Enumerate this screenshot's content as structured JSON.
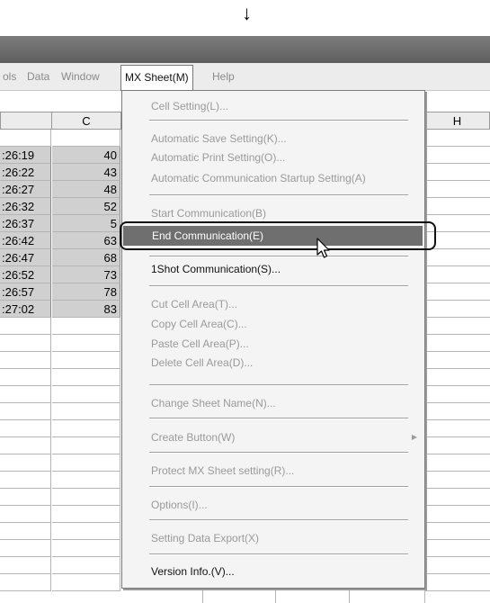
{
  "arrow": "↓",
  "menubar": {
    "items": [
      {
        "label": "ols"
      },
      {
        "label": "Data"
      },
      {
        "label": "Window"
      },
      {
        "label": "MX Sheet(M)"
      },
      {
        "label": "Help"
      }
    ]
  },
  "sheet": {
    "column_headers": [
      "C",
      "H"
    ],
    "rows": [
      {
        "time": ":26:19",
        "value": "40"
      },
      {
        "time": ":26:22",
        "value": "43"
      },
      {
        "time": ":26:27",
        "value": "48"
      },
      {
        "time": ":26:32",
        "value": "52"
      },
      {
        "time": ":26:37",
        "value": "5"
      },
      {
        "time": ":26:42",
        "value": "63"
      },
      {
        "time": ":26:47",
        "value": "68"
      },
      {
        "time": ":26:52",
        "value": "73"
      },
      {
        "time": ":26:57",
        "value": "78"
      },
      {
        "time": ":27:02",
        "value": "83"
      }
    ]
  },
  "dropdown": {
    "items": [
      {
        "label": "Cell Setting(L)...",
        "enabled": false
      },
      {
        "label": "Automatic Save Setting(K)...",
        "enabled": false
      },
      {
        "label": "Automatic Print Setting(O)...",
        "enabled": false
      },
      {
        "label": "Automatic Communication Startup Setting(A)",
        "enabled": false
      },
      {
        "label": "Start Communication(B)",
        "enabled": false
      },
      {
        "label": "End Communication(E)",
        "enabled": true,
        "highlighted": true
      },
      {
        "label": "1Shot Communication(S)...",
        "enabled": true
      },
      {
        "label": "Cut Cell Area(T)...",
        "enabled": false
      },
      {
        "label": "Copy Cell Area(C)...",
        "enabled": false
      },
      {
        "label": "Paste Cell Area(P)...",
        "enabled": false
      },
      {
        "label": "Delete Cell Area(D)...",
        "enabled": false
      },
      {
        "label": "Change Sheet Name(N)...",
        "enabled": false
      },
      {
        "label": "Create Button(W)",
        "enabled": false,
        "submenu": true
      },
      {
        "label": "Protect MX Sheet setting(R)...",
        "enabled": false
      },
      {
        "label": "Options(I)...",
        "enabled": false
      },
      {
        "label": "Setting Data Export(X)",
        "enabled": false
      },
      {
        "label": "Version Info.(V)...",
        "enabled": true
      }
    ]
  },
  "colors": {
    "highlight": "#6f6f6f",
    "selected_cells": "#d0d0d0",
    "titlebar": "#6b6b6b"
  }
}
